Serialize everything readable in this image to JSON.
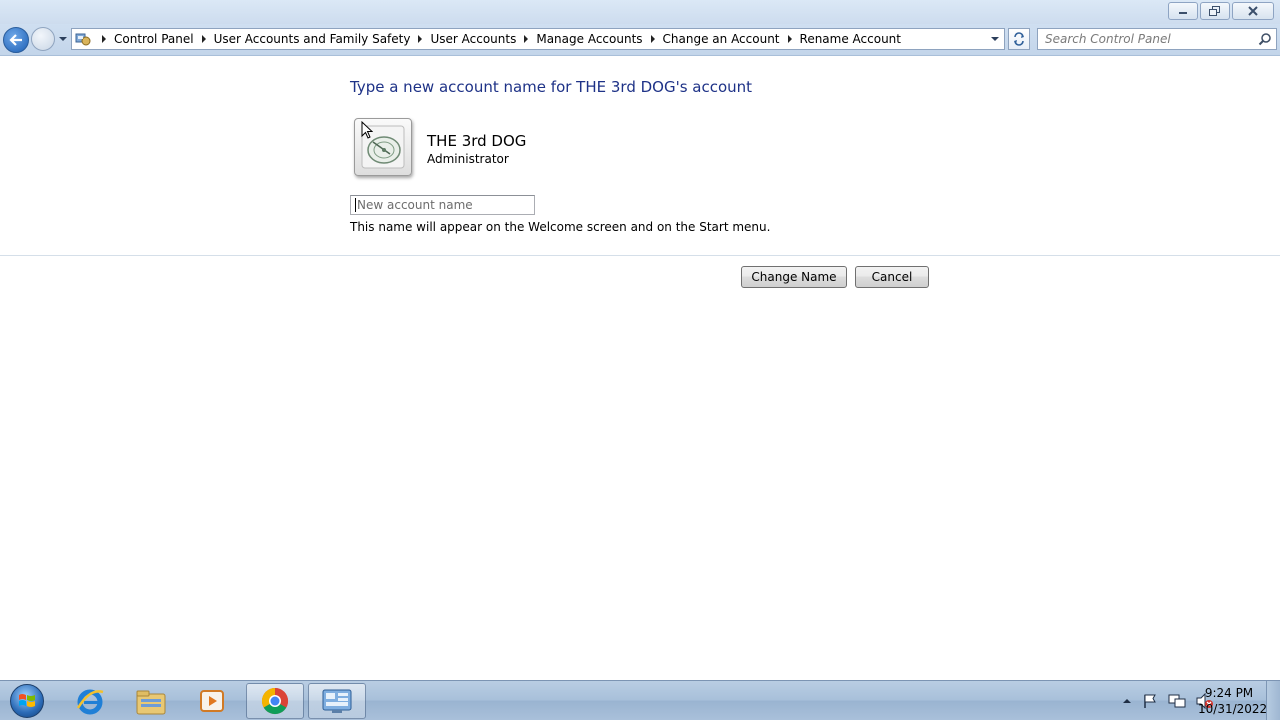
{
  "window": {
    "caption_buttons": [
      "minimize-icon",
      "restore-icon",
      "close-icon"
    ]
  },
  "navigation": {
    "breadcrumbs": [
      "Control Panel",
      "User Accounts and Family Safety",
      "User Accounts",
      "Manage Accounts",
      "Change an Account",
      "Rename Account"
    ],
    "search_placeholder": "Search Control Panel"
  },
  "main": {
    "heading": "Type a new account name for THE 3rd DOG's account",
    "account": {
      "name": "THE 3rd DOG",
      "role": "Administrator"
    },
    "name_input": {
      "value": "",
      "placeholder": "New account name"
    },
    "hint": "This name will appear on the Welcome screen and on the Start menu.",
    "buttons": {
      "change_name": "Change Name",
      "cancel": "Cancel"
    }
  },
  "taskbar": {
    "pinned": [
      "internet-explorer-icon",
      "windows-explorer-icon",
      "media-player-icon",
      "chrome-icon",
      "control-panel-icon"
    ],
    "active": "control-panel-icon",
    "clock": {
      "time": "9:24 PM",
      "date": "10/31/2022"
    }
  },
  "colors": {
    "heading": "#1e3287",
    "accent": "#2b6bb7"
  }
}
